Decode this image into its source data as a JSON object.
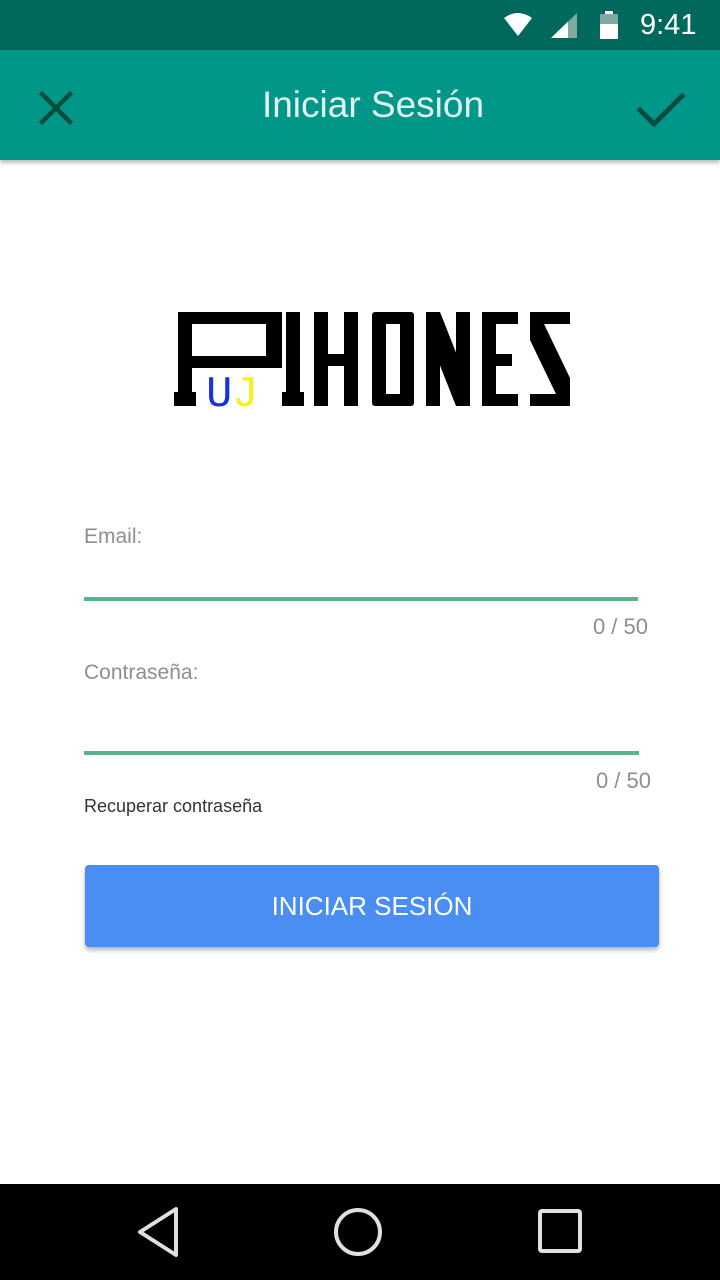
{
  "status_bar": {
    "time": "9:41",
    "icons": [
      "wifi-icon",
      "signal-icon",
      "battery-icon"
    ]
  },
  "app_bar": {
    "title": "Iniciar Sesión",
    "close_icon": "close-icon",
    "confirm_icon": "check-icon",
    "background_color": "#009688"
  },
  "logo": {
    "text": "PHONES",
    "letters_u": "U",
    "letters_j": "J",
    "u_color": "#1a2fe6",
    "j_color": "#f7f01e"
  },
  "form": {
    "email": {
      "label": "Email:",
      "value": "",
      "counter": "0 / 50"
    },
    "password": {
      "label": "Contraseña:",
      "value": "",
      "counter": "0 / 50"
    },
    "recover_label": "Recuperar contraseña",
    "submit_label": "INICIAR SESIÓN",
    "accent_color": "#56b58a",
    "button_color": "#4a8ef3"
  },
  "nav_bar": {
    "icons": [
      "back-icon",
      "home-icon",
      "recents-icon"
    ]
  }
}
